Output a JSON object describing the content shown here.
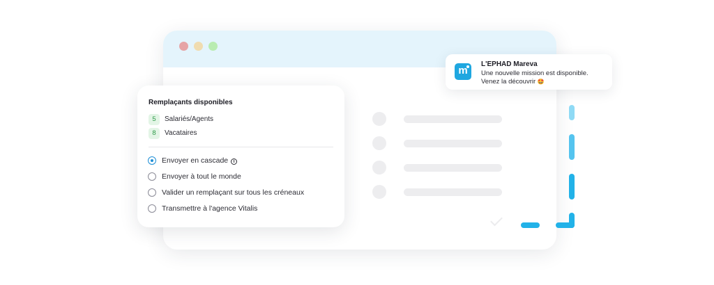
{
  "toast": {
    "title": "L'EPHAD Mareva",
    "message": "Une nouvelle mission est disponible. Venez la découvrir",
    "emoji": "🤩",
    "logo_letter": "m",
    "logo_color": "#1fa7e0"
  },
  "panel": {
    "title": "Remplaçants disponibles",
    "stats": [
      {
        "count": "5",
        "label": "Salariés/Agents"
      },
      {
        "count": "8",
        "label": "Vacataires"
      }
    ],
    "options": [
      {
        "label": "Envoyer en cascade",
        "selected": true,
        "info_icon": "info-icon"
      },
      {
        "label": "Envoyer à tout le monde",
        "selected": false
      },
      {
        "label": "Valider un remplaçant sur tous les créneaux",
        "selected": false
      },
      {
        "label": "Transmettre à l'agence Vitalis",
        "selected": false
      }
    ]
  },
  "colors": {
    "accent": "#1f8fd6",
    "browser_bar": "#e4f4fc",
    "dash": "#22b2e8",
    "badge_bg": "#e3f5e6",
    "badge_text": "#2d9a48"
  }
}
